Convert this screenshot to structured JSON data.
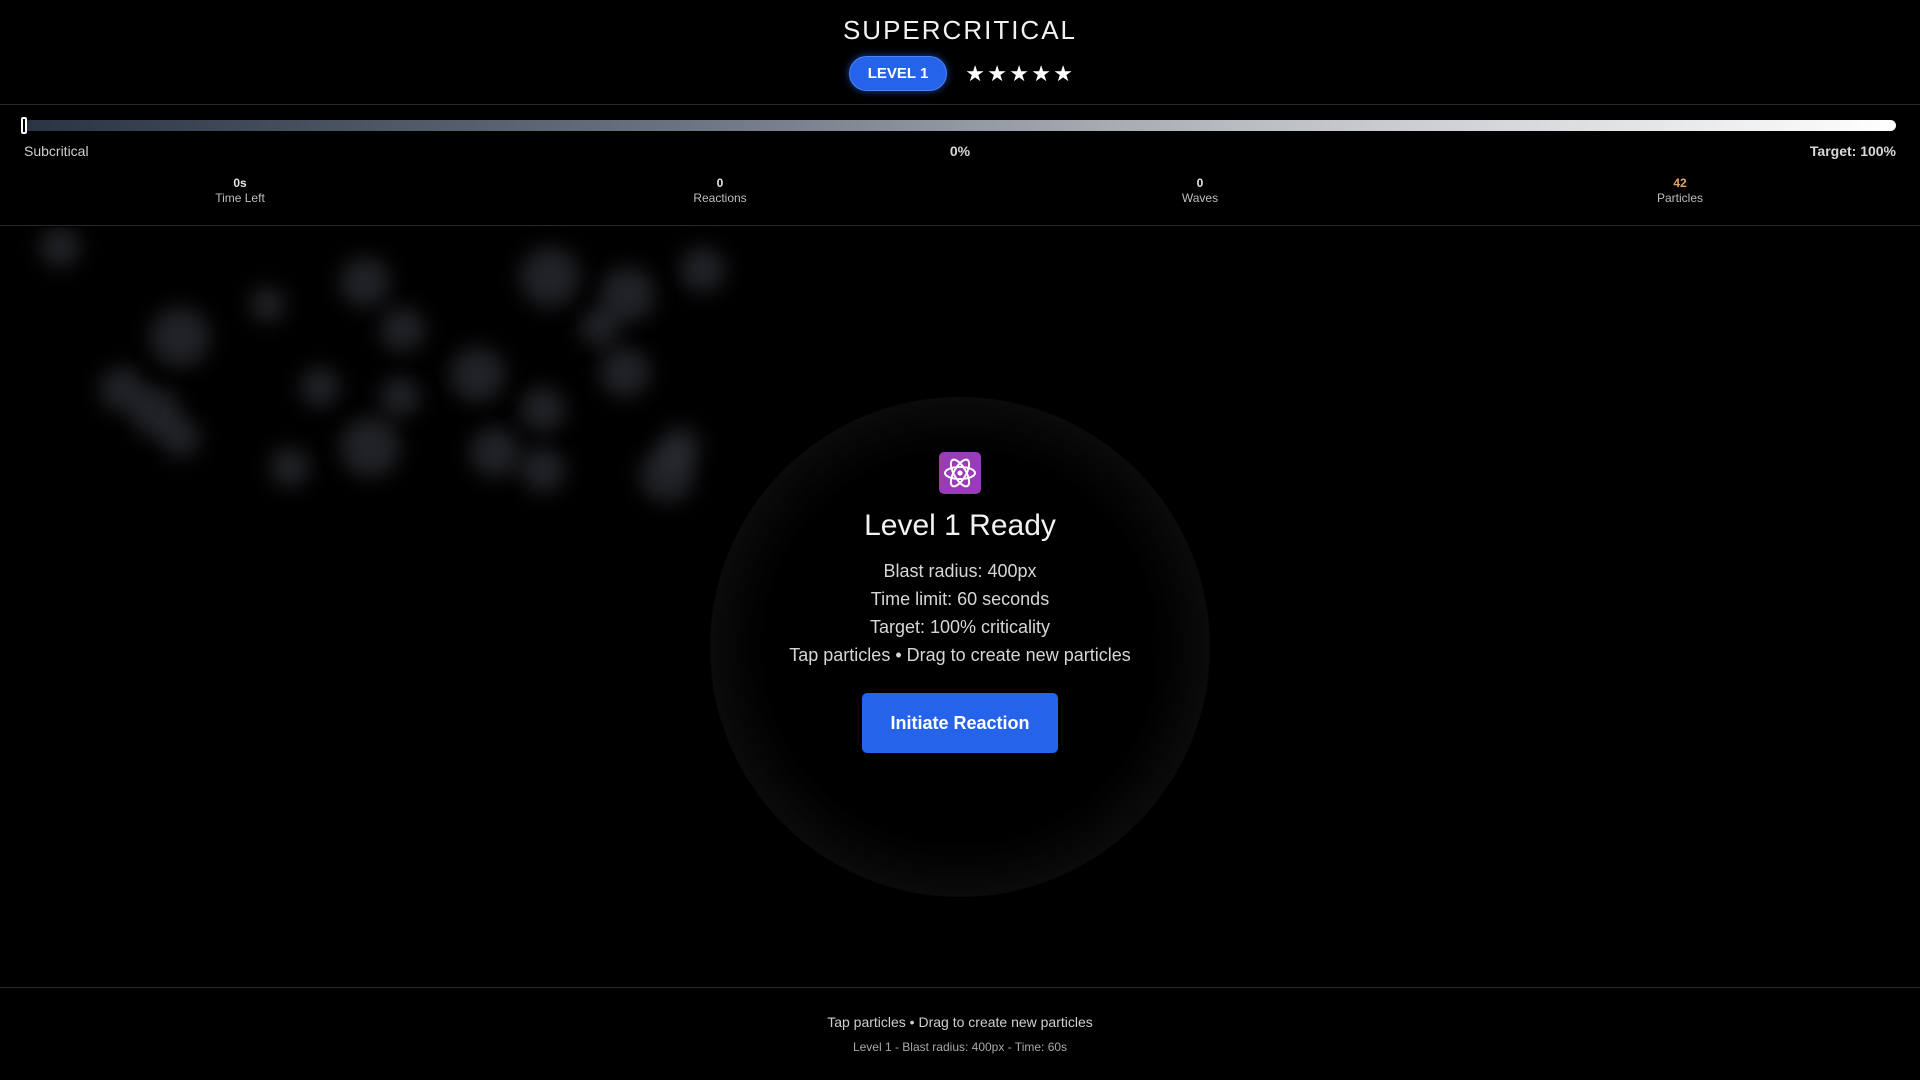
{
  "header": {
    "title": "SUPERCRITICAL",
    "level_badge": "LEVEL 1",
    "stars": [
      "★",
      "★",
      "★",
      "★",
      "★"
    ]
  },
  "meter": {
    "left_label": "Subcritical",
    "center_label": "0%",
    "right_label": "Target: 100%",
    "progress": 0
  },
  "stats": [
    {
      "value": "0s",
      "label": "Time Left"
    },
    {
      "value": "0",
      "label": "Reactions"
    },
    {
      "value": "0",
      "label": "Waves"
    },
    {
      "value": "42",
      "label": "Particles",
      "color": "#e0a36a"
    }
  ],
  "panel": {
    "icon": "atom-icon",
    "title": "Level 1 Ready",
    "lines": [
      "Blast radius: 400px",
      "Time limit: 60 seconds",
      "Target: 100% criticality",
      "Tap particles • Drag to create new particles"
    ],
    "button_label": "Initiate Reaction"
  },
  "footer": {
    "hint": "Tap particles • Drag to create new particles",
    "info": "Level 1 - Blast radius: 400px - Time: 60s"
  },
  "colors": {
    "accent": "#2563eb",
    "atom_bg": "#9b3cb7"
  }
}
